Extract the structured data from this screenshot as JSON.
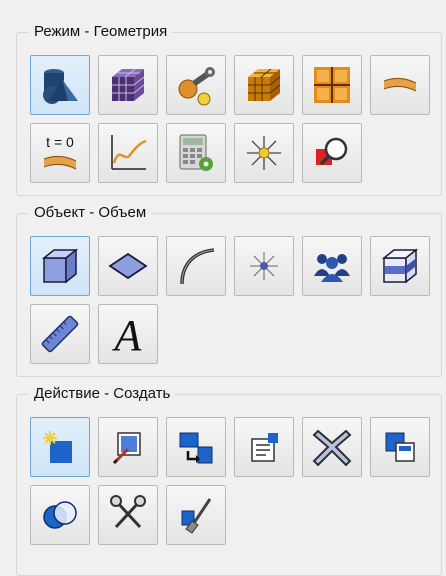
{
  "groups": [
    {
      "title": "Режим - Геометрия",
      "buttons": [
        {
          "name": "geometry-mode",
          "icon": "geometry-shapes-icon",
          "active": true
        },
        {
          "name": "mesh-mode",
          "icon": "mesh-cube-icon",
          "active": false
        },
        {
          "name": "physics-mode",
          "icon": "wrench-physics-icon",
          "active": false
        },
        {
          "name": "solve-mode",
          "icon": "solver-cube-icon",
          "active": false
        },
        {
          "name": "grid-mode",
          "icon": "grid-frame-icon",
          "active": false
        },
        {
          "name": "boundary-mode",
          "icon": "boundary-strip-icon",
          "active": false
        },
        {
          "name": "initial-conditions-mode",
          "icon": "t-zero-icon",
          "label": "t = 0",
          "active": false
        },
        {
          "name": "plot-mode",
          "icon": "plot-curve-icon",
          "active": false
        },
        {
          "name": "calculator-mode",
          "icon": "calculator-gear-icon",
          "active": false
        },
        {
          "name": "light-mode",
          "icon": "sun-ray-icon",
          "active": false
        },
        {
          "name": "zoom-mode",
          "icon": "zoom-search-icon",
          "active": false
        }
      ]
    },
    {
      "title": "Объект - Объем",
      "buttons": [
        {
          "name": "volume-object",
          "icon": "cube-volume-icon",
          "active": true
        },
        {
          "name": "surface-object",
          "icon": "surface-diamond-icon",
          "active": false
        },
        {
          "name": "curve-object",
          "icon": "curve-arc-icon",
          "active": false
        },
        {
          "name": "point-object",
          "icon": "point-star-icon",
          "active": false
        },
        {
          "name": "group-object",
          "icon": "people-group-icon",
          "active": false
        },
        {
          "name": "layered-object",
          "icon": "layered-cube-icon",
          "active": false
        },
        {
          "name": "measure-object",
          "icon": "ruler-icon",
          "active": false
        },
        {
          "name": "text-object",
          "icon": "text-a-icon",
          "label": "A",
          "active": false
        }
      ]
    },
    {
      "title": "Действие - Создать",
      "buttons": [
        {
          "name": "create-action",
          "icon": "create-new-icon",
          "active": true
        },
        {
          "name": "edit-action",
          "icon": "edit-image-icon",
          "active": false
        },
        {
          "name": "transform-action",
          "icon": "transform-arrow-icon",
          "active": false
        },
        {
          "name": "properties-action",
          "icon": "properties-card-icon",
          "active": false
        },
        {
          "name": "delete-action",
          "icon": "delete-x-icon",
          "active": false
        },
        {
          "name": "copy-action",
          "icon": "copy-squares-icon",
          "active": false
        },
        {
          "name": "boolean-action",
          "icon": "boolean-circles-icon",
          "active": false
        },
        {
          "name": "cut-action",
          "icon": "scissors-icon",
          "active": false
        },
        {
          "name": "clean-action",
          "icon": "broom-icon",
          "active": false
        }
      ]
    }
  ]
}
